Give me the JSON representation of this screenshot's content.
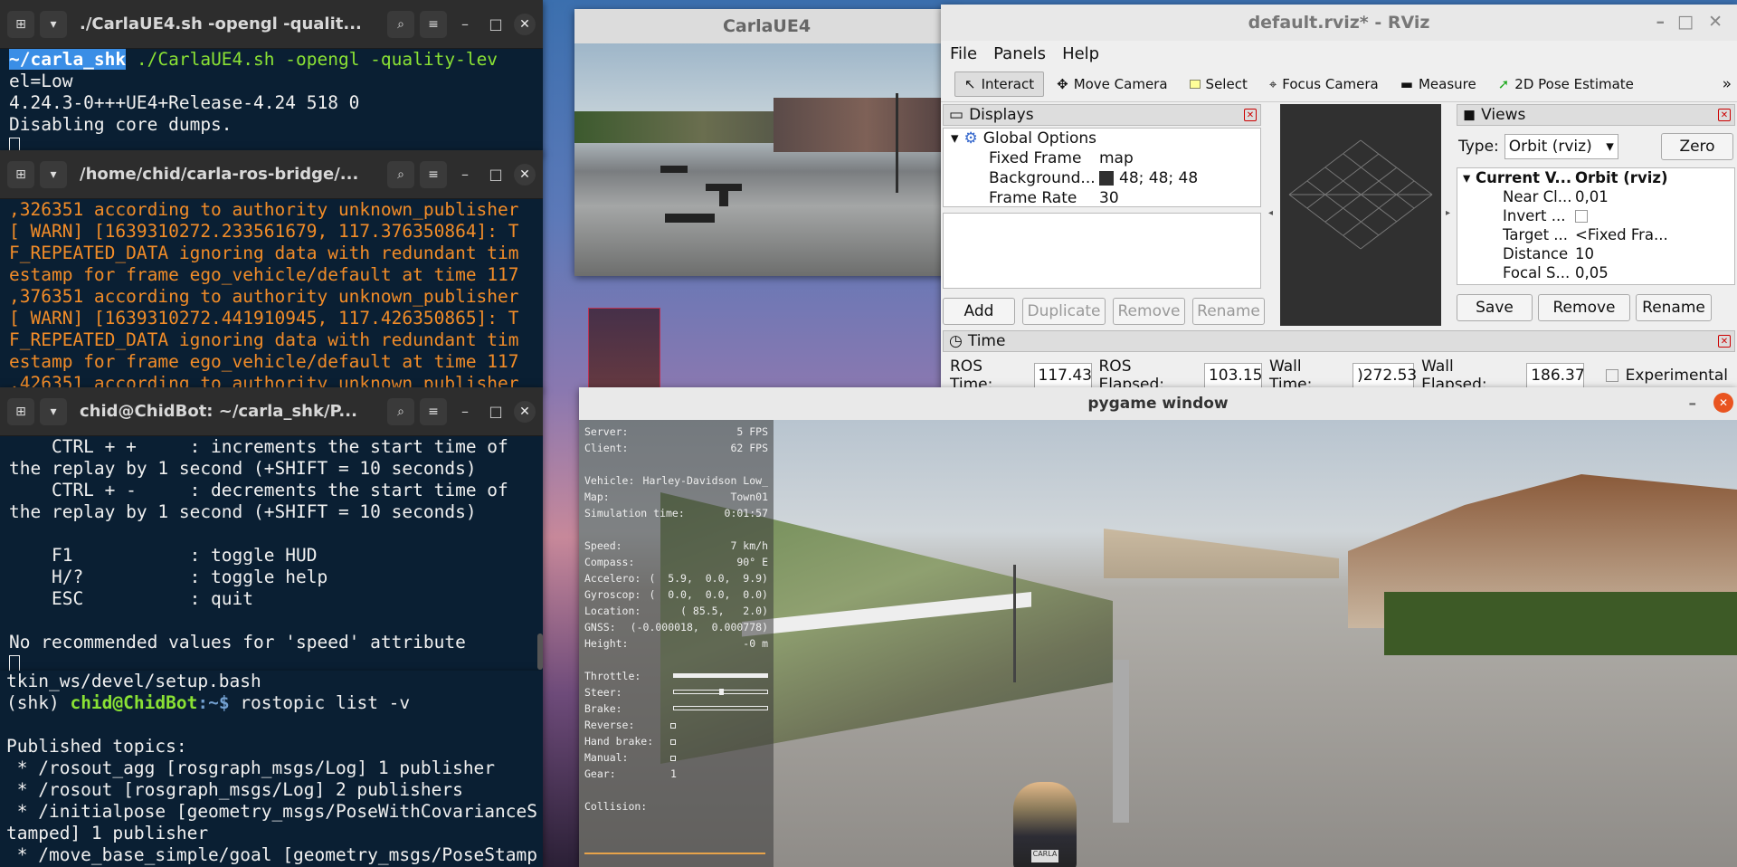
{
  "terminal1": {
    "title": "./CarlaUE4.sh -opengl -qualit...",
    "prompt": "~/carla_shk",
    "command": "./CarlaUE4.sh -opengl -quality-lev",
    "command_wrap": "el=Low",
    "lines": [
      "4.24.3-0+++UE4+Release-4.24 518 0",
      "Disabling core dumps."
    ]
  },
  "terminal2": {
    "title": "/home/chid/carla-ros-bridge/...",
    "lines": [
      ",326351 according to authority unknown_publisher",
      "[ WARN] [1639310272.233561679, 117.376350864]: T",
      "F_REPEATED_DATA ignoring data with redundant tim",
      "estamp for frame ego_vehicle/default at time 117",
      ",376351 according to authority unknown_publisher",
      "[ WARN] [1639310272.441910945, 117.426350865]: T",
      "F_REPEATED_DATA ignoring data with redundant tim",
      "estamp for frame ego_vehicle/default at time 117",
      ",426351 according to authority unknown_publisher"
    ]
  },
  "terminal3": {
    "title": "chid@ChidBot: ~/carla_shk/P...",
    "lines": [
      "    CTRL + +     : increments the start time of",
      "the replay by 1 second (+SHIFT = 10 seconds)",
      "    CTRL + -     : decrements the start time of",
      "the replay by 1 second (+SHIFT = 10 seconds)",
      "",
      "    F1           : toggle HUD",
      "    H/?          : toggle help",
      "    ESC          : quit",
      "",
      "No recommended values for 'speed' attribute"
    ]
  },
  "terminal4": {
    "line0": "tkin_ws/devel/setup.bash",
    "env": "(shk) ",
    "user": "chid@ChidBot",
    "path": ":~$ ",
    "cmd": "rostopic list -v",
    "lines": [
      "",
      "Published topics:",
      " * /rosout_agg [rosgraph_msgs/Log] 1 publisher",
      " * /rosout [rosgraph_msgs/Log] 2 publishers",
      " * /initialpose [geometry_msgs/PoseWithCovarianceS",
      "tamped] 1 publisher",
      " * /move_base_simple/goal [geometry_msgs/PoseStamp"
    ]
  },
  "carla": {
    "title": "CarlaUE4"
  },
  "rviz": {
    "title": "default.rviz* - RViz",
    "menu": [
      "File",
      "Panels",
      "Help"
    ],
    "tools": [
      "Interact",
      "Move Camera",
      "Select",
      "Focus Camera",
      "Measure",
      "2D Pose Estimate"
    ],
    "displays": {
      "header": "Displays",
      "global": "Global Options",
      "rows": [
        {
          "k": "Fixed Frame",
          "v": "map"
        },
        {
          "k": "Background...",
          "v": "48; 48; 48"
        },
        {
          "k": "Frame Rate",
          "v": "30"
        }
      ],
      "buttons": [
        "Add",
        "Duplicate",
        "Remove",
        "Rename"
      ]
    },
    "views": {
      "header": "Views",
      "type_label": "Type:",
      "type_value": "Orbit (rviz)",
      "zero": "Zero",
      "current": "Current V...",
      "current_v": "Orbit (rviz)",
      "rows": [
        {
          "k": "Near Cl...",
          "v": "0,01"
        },
        {
          "k": "Invert ...",
          "v": ""
        },
        {
          "k": "Target ...",
          "v": "<Fixed Fra..."
        },
        {
          "k": "Distance",
          "v": "10"
        },
        {
          "k": "Focal S...",
          "v": "0,05"
        }
      ],
      "buttons": [
        "Save",
        "Remove",
        "Rename"
      ]
    },
    "time": {
      "header": "Time",
      "ros_time_label": "ROS Time:",
      "ros_time": "117.43",
      "ros_elapsed_label": "ROS Elapsed:",
      "ros_elapsed": "103.15",
      "wall_time_label": "Wall Time:",
      "wall_time": ")272.53",
      "wall_elapsed_label": "Wall Elapsed:",
      "wall_elapsed": "186.37",
      "experimental": "Experimental"
    }
  },
  "pygame": {
    "title": "pygame window",
    "hud": {
      "server": "5 FPS",
      "client": "62 FPS",
      "vehicle": "Harley-Davidson Low_",
      "map": "Town01",
      "sim_time": "0:01:57",
      "speed": "7 km/h",
      "compass": "90° E",
      "accelero": "(  5.9,  0.0,  9.9)",
      "gyroscop": "(  0.0,  0.0,  0.0)",
      "location": "( 85.5,   2.0)",
      "gnss": "(-0.000018,  0.000778)",
      "height": "-0 m",
      "gear": "1",
      "labels": {
        "server": "Server:",
        "client": "Client:",
        "vehicle": "Vehicle:",
        "map": "Map:",
        "sim_time": "Simulation time:",
        "speed": "Speed:",
        "compass": "Compass:",
        "accelero": "Accelero:",
        "gyroscop": "Gyroscop:",
        "location": "Location:",
        "gnss": "GNSS:",
        "height": "Height:",
        "throttle": "Throttle:",
        "steer": "Steer:",
        "brake": "Brake:",
        "reverse": "Reverse:",
        "hand_brake": "Hand brake:",
        "manual": "Manual:",
        "gear": "Gear:",
        "collision": "Collision:"
      }
    },
    "plate": "CARLA"
  }
}
